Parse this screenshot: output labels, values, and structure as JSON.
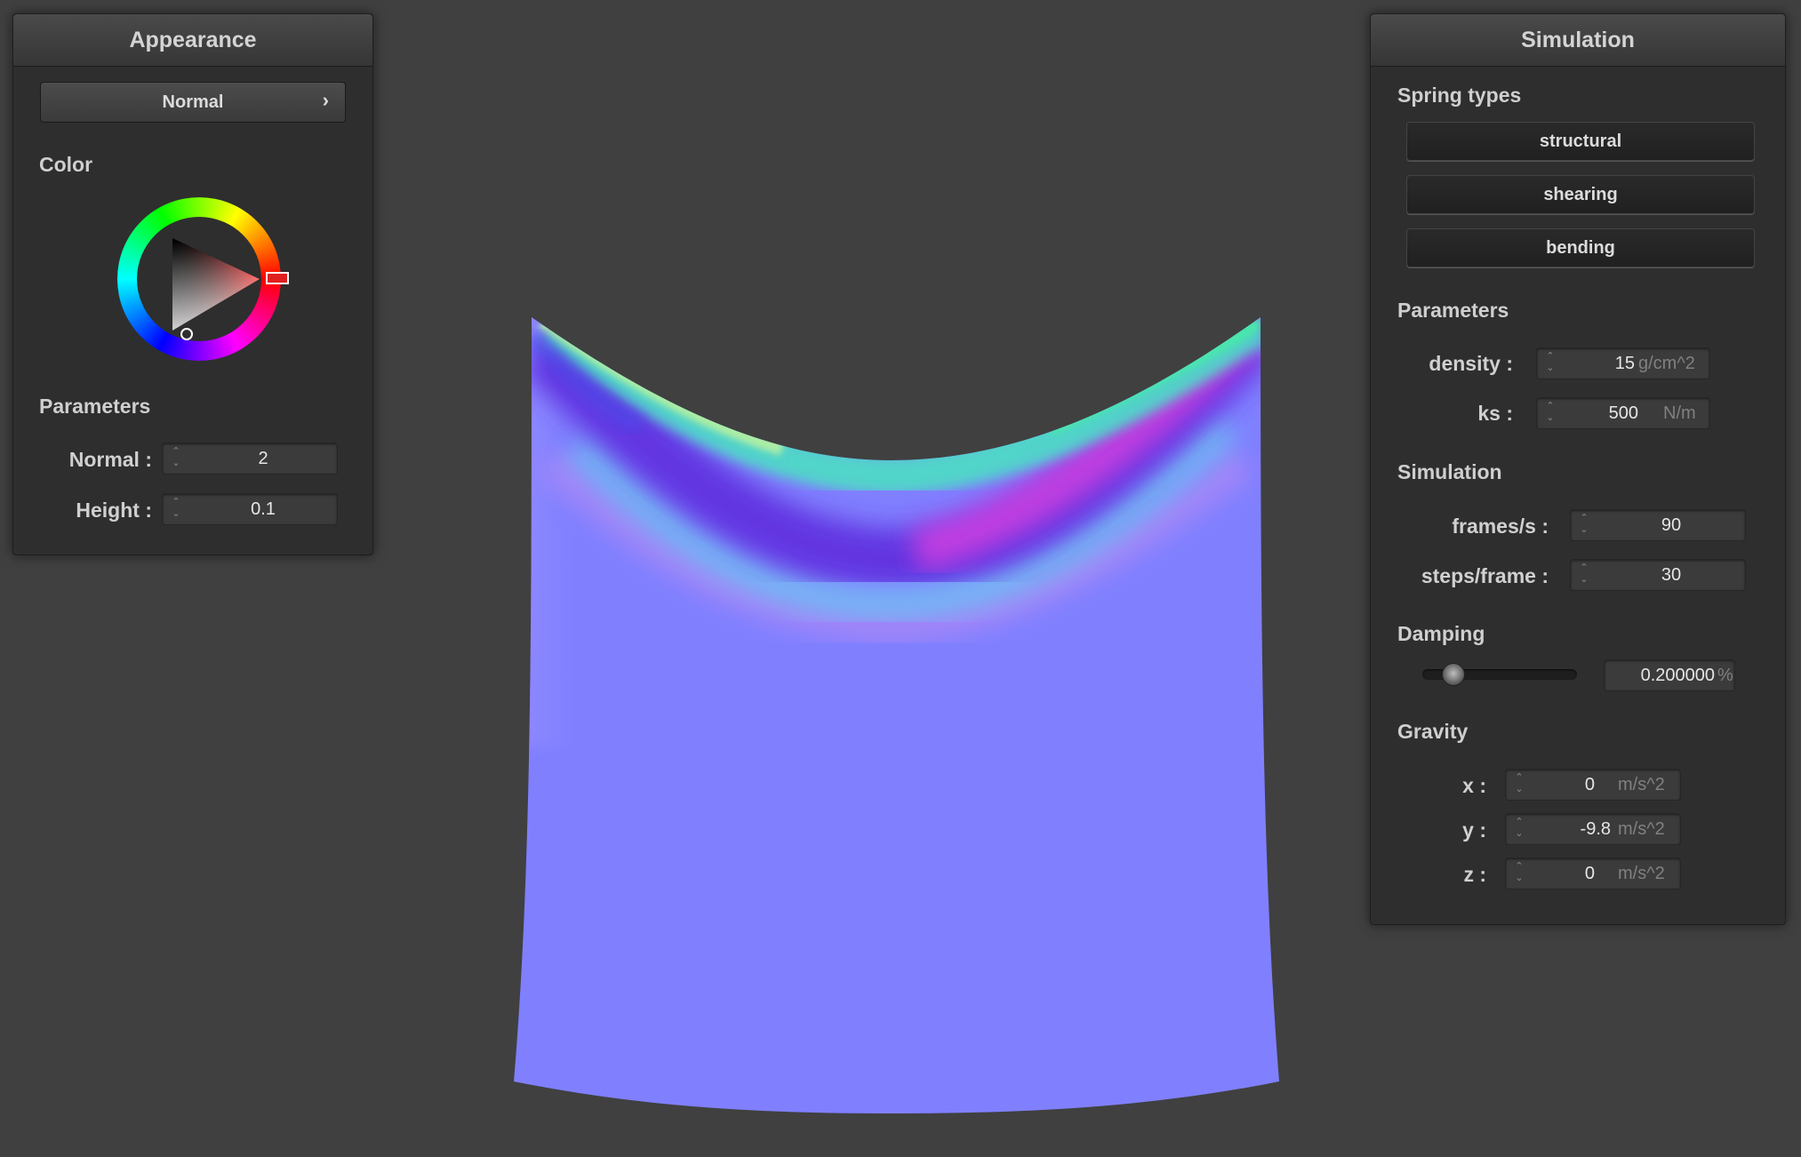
{
  "colors": {
    "background": "#404040",
    "panel": "#2e2e2e",
    "cloth_base": "#8080ff",
    "color_selected": "#ff0000"
  },
  "appearance": {
    "title": "Appearance",
    "shader_select": "Normal",
    "chevron": "›",
    "color_label": "Color",
    "parameters_label": "Parameters",
    "normal_label": "Normal :",
    "normal_value": "2",
    "height_label": "Height :",
    "height_value": "0.1"
  },
  "simulation": {
    "title": "Simulation",
    "spring_types_label": "Spring types",
    "spring_buttons": [
      "structural",
      "shearing",
      "bending"
    ],
    "parameters_label": "Parameters",
    "density_label": "density :",
    "density_value": "15",
    "density_unit": "g/cm^2",
    "ks_label": "ks :",
    "ks_value": "500",
    "ks_unit": "N/m",
    "simulation_label": "Simulation",
    "fps_label": "frames/s :",
    "fps_value": "90",
    "steps_label": "steps/frame :",
    "steps_value": "30",
    "damping_label": "Damping",
    "damping_value": "0.200000",
    "damping_unit": "%",
    "damping_level": 0.2,
    "gravity_label": "Gravity",
    "gx_label": "x :",
    "gx_value": "0",
    "gy_label": "y :",
    "gy_value": "-9.8",
    "gz_label": "z :",
    "gz_value": "0",
    "gravity_unit": "m/s^2"
  }
}
